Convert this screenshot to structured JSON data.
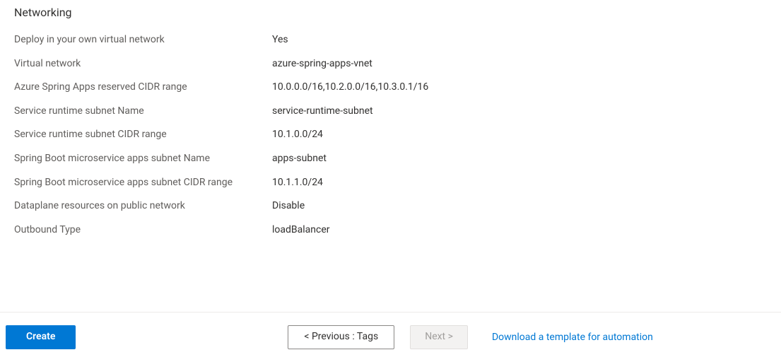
{
  "section": {
    "heading": "Networking",
    "rows": [
      {
        "label": "Deploy in your own virtual network",
        "value": "Yes"
      },
      {
        "label": "Virtual network",
        "value": "azure-spring-apps-vnet"
      },
      {
        "label": "Azure Spring Apps reserved CIDR range",
        "value": "10.0.0.0/16,10.2.0.0/16,10.3.0.1/16"
      },
      {
        "label": "Service runtime subnet Name",
        "value": "service-runtime-subnet"
      },
      {
        "label": "Service runtime subnet CIDR range",
        "value": "10.1.0.0/24"
      },
      {
        "label": "Spring Boot microservice apps subnet Name",
        "value": "apps-subnet"
      },
      {
        "label": "Spring Boot microservice apps subnet CIDR range",
        "value": "10.1.1.0/24"
      },
      {
        "label": "Dataplane resources on public network",
        "value": "Disable"
      },
      {
        "label": "Outbound Type",
        "value": "loadBalancer"
      }
    ]
  },
  "footer": {
    "create_label": "Create",
    "previous_label": "< Previous : Tags",
    "next_label": "Next >",
    "download_link": "Download a template for automation"
  }
}
